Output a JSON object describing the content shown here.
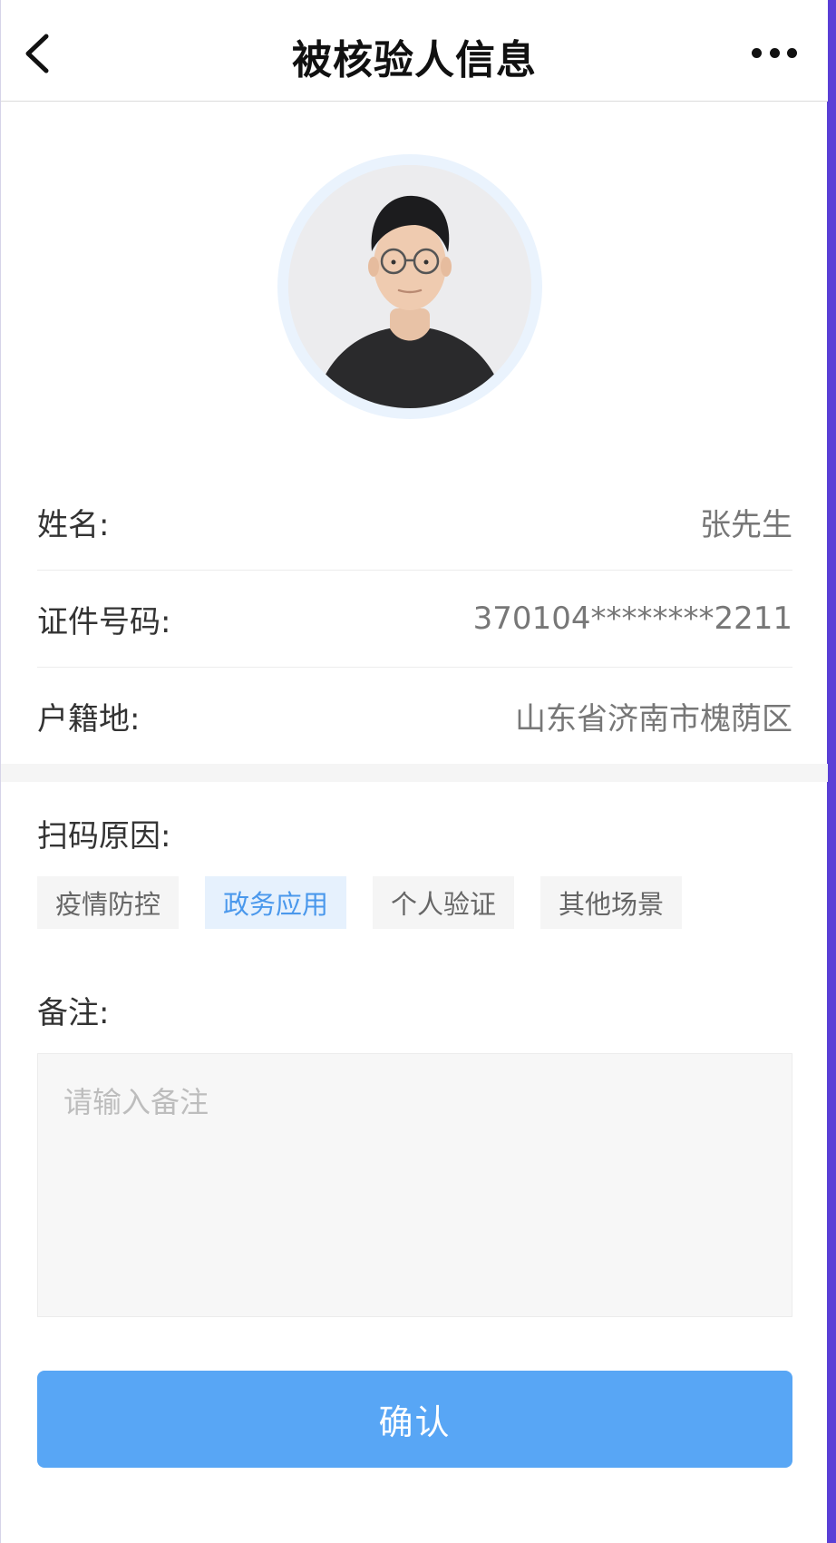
{
  "header": {
    "title": "被核验人信息",
    "back_icon": "chevron-left-icon",
    "more_icon": "more-horizontal-icon"
  },
  "profile": {
    "avatar": "portrait-photo"
  },
  "info": {
    "name": {
      "label": "姓名:",
      "value": "张先生"
    },
    "id_number": {
      "label": "证件号码:",
      "value": "370104********2211"
    },
    "domicile": {
      "label": "户籍地:",
      "value": "山东省济南市槐荫区"
    }
  },
  "scan_reason": {
    "label": "扫码原因:",
    "options": [
      "疫情防控",
      "政务应用",
      "个人验证",
      "其他场景"
    ],
    "selected": "政务应用"
  },
  "remark": {
    "label": "备注:",
    "placeholder": "请输入备注",
    "value": ""
  },
  "actions": {
    "confirm_label": "确认"
  },
  "colors": {
    "accent": "#58a6f5",
    "tag_active_text": "#4a98ec",
    "tag_active_bg": "#e6f1fd",
    "edge_stripe": "#5a3fd6"
  }
}
